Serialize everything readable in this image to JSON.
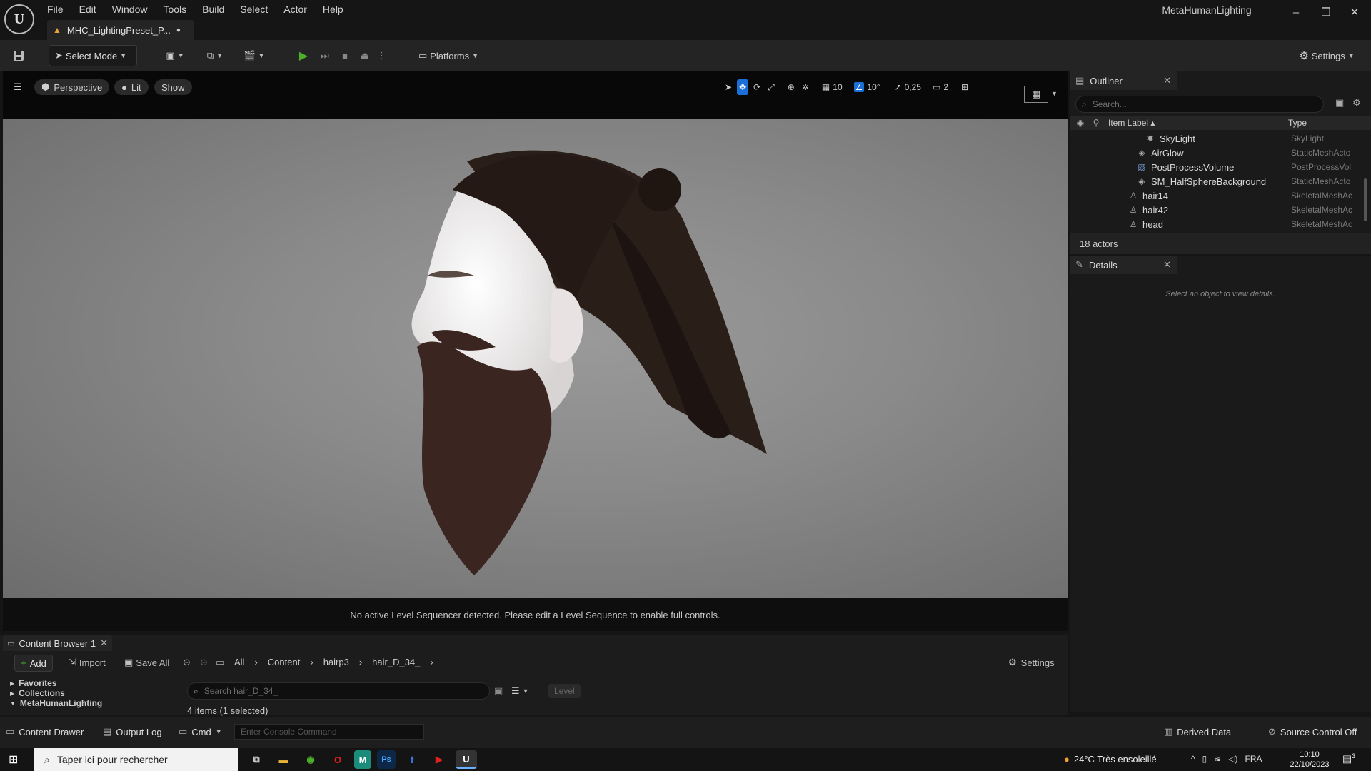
{
  "app": {
    "window_title": "MetaHumanLighting",
    "doc_tab": "MHC_LightingPreset_P...",
    "menu": [
      "File",
      "Edit",
      "Window",
      "Tools",
      "Build",
      "Select",
      "Actor",
      "Help"
    ]
  },
  "toolbar": {
    "select_mode": "Select Mode",
    "platforms": "Platforms",
    "settings": "Settings"
  },
  "viewport": {
    "perspective": "Perspective",
    "lit": "Lit",
    "show": "Show",
    "grid_snap": "10",
    "rot_snap": "10°",
    "scale_snap": "0,25",
    "cam_speed": "2",
    "sequencer_msg": "No active Level Sequencer detected. Please edit a Level Sequence to enable full controls."
  },
  "outliner": {
    "title": "Outliner",
    "search_placeholder": "Search...",
    "col_label": "Item Label",
    "col_type": "Type",
    "rows": [
      {
        "label": "SkyLight",
        "type": "SkyLight",
        "icon": "light-icon"
      },
      {
        "label": "AirGlow",
        "type": "StaticMeshActo",
        "icon": "mesh-icon"
      },
      {
        "label": "PostProcessVolume",
        "type": "PostProcessVol",
        "icon": "volume-icon"
      },
      {
        "label": "SM_HalfSphereBackground",
        "type": "StaticMeshActo",
        "icon": "mesh-icon"
      },
      {
        "label": "hair14",
        "type": "SkeletalMeshAc",
        "icon": "skeletal-icon"
      },
      {
        "label": "hair42",
        "type": "SkeletalMeshAc",
        "icon": "skeletal-icon"
      },
      {
        "label": "head",
        "type": "SkeletalMeshAc",
        "icon": "skeletal-icon"
      }
    ],
    "actor_count": "18 actors"
  },
  "details": {
    "title": "Details",
    "empty_msg": "Select an object to view details."
  },
  "content_browser": {
    "tab": "Content Browser 1",
    "add": "Add",
    "import": "Import",
    "save_all": "Save All",
    "breadcrumb": [
      "All",
      "Content",
      "hairp3",
      "hair_D_34_"
    ],
    "settings": "Settings",
    "search_placeholder": "Search hair_D_34_",
    "filter_chip": "Level",
    "tree": [
      "Favorites",
      "Collections",
      "MetaHumanLighting"
    ],
    "items_count": "4 items (1 selected)"
  },
  "statusbar": {
    "content_drawer": "Content Drawer",
    "output_log": "Output Log",
    "cmd": "Cmd",
    "console_placeholder": "Enter Console Command",
    "derived_data": "Derived Data",
    "source_control": "Source Control Off"
  },
  "taskbar": {
    "search_placeholder": "Taper ici pour rechercher",
    "weather": "24°C  Très ensoleillé",
    "lang": "FRA",
    "time": "10:10",
    "date": "22/10/2023",
    "notif_count": "3"
  },
  "colors": {
    "accent_blue": "#1b6fd8",
    "play_green": "#4caf2a",
    "warning_orange": "#e8a43a"
  }
}
